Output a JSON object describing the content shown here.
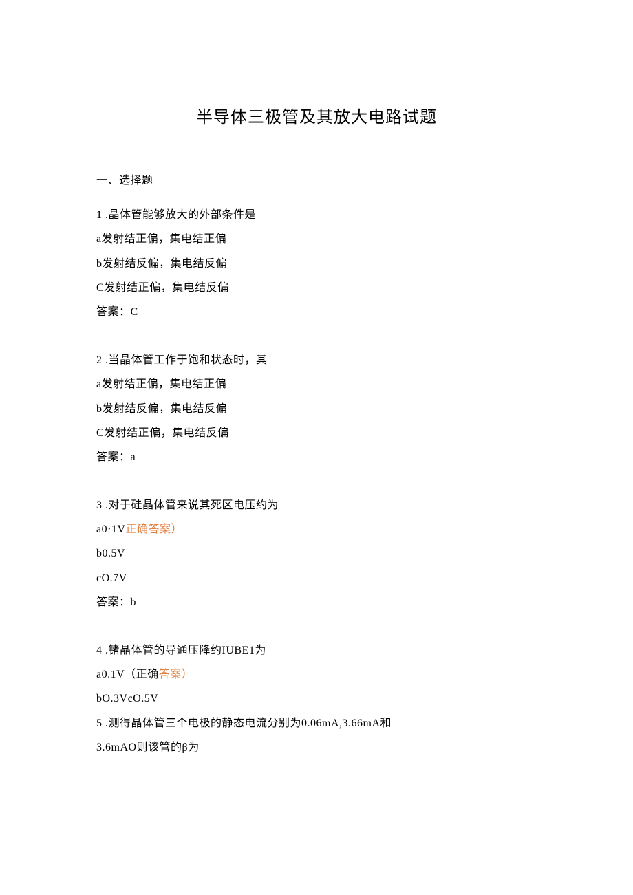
{
  "title": "半导体三极管及其放大电路试题",
  "section_heading": "一、选择题",
  "q1": {
    "stem": "1 .晶体管能够放大的外部条件是",
    "a": "a发射结正偏，集电结正偏",
    "b": "b发射结反偏，集电结反偏",
    "c": "C发射结正偏，集电结反偏",
    "answer": "答案：C"
  },
  "q2": {
    "stem": "2 .当晶体管工作于饱和状态时，其",
    "a": "a发射结正偏，集电结正偏",
    "b": "b发射结反偏，集电结反偏",
    "c": "C发射结正偏，集电结反偏",
    "answer": "答案：a"
  },
  "q3": {
    "stem": "3 .对于硅晶体管来说其死区电压约为",
    "a_prefix": "a0·1V",
    "a_highlight": "正确答案）",
    "b": "b0.5V",
    "c": "cO.7V",
    "answer": "答案：b"
  },
  "q4": {
    "stem": "4 .锗晶体管的导通压降约IUBE1为",
    "a_prefix": "a0.1V（正确",
    "a_highlight": "答案）",
    "b": "bO.3VcO.5V"
  },
  "q5": {
    "line1": "5 .测得晶体管三个电极的静态电流分别为0.06mA,3.66mA和",
    "line2": "3.6mAO则该管的β为"
  }
}
